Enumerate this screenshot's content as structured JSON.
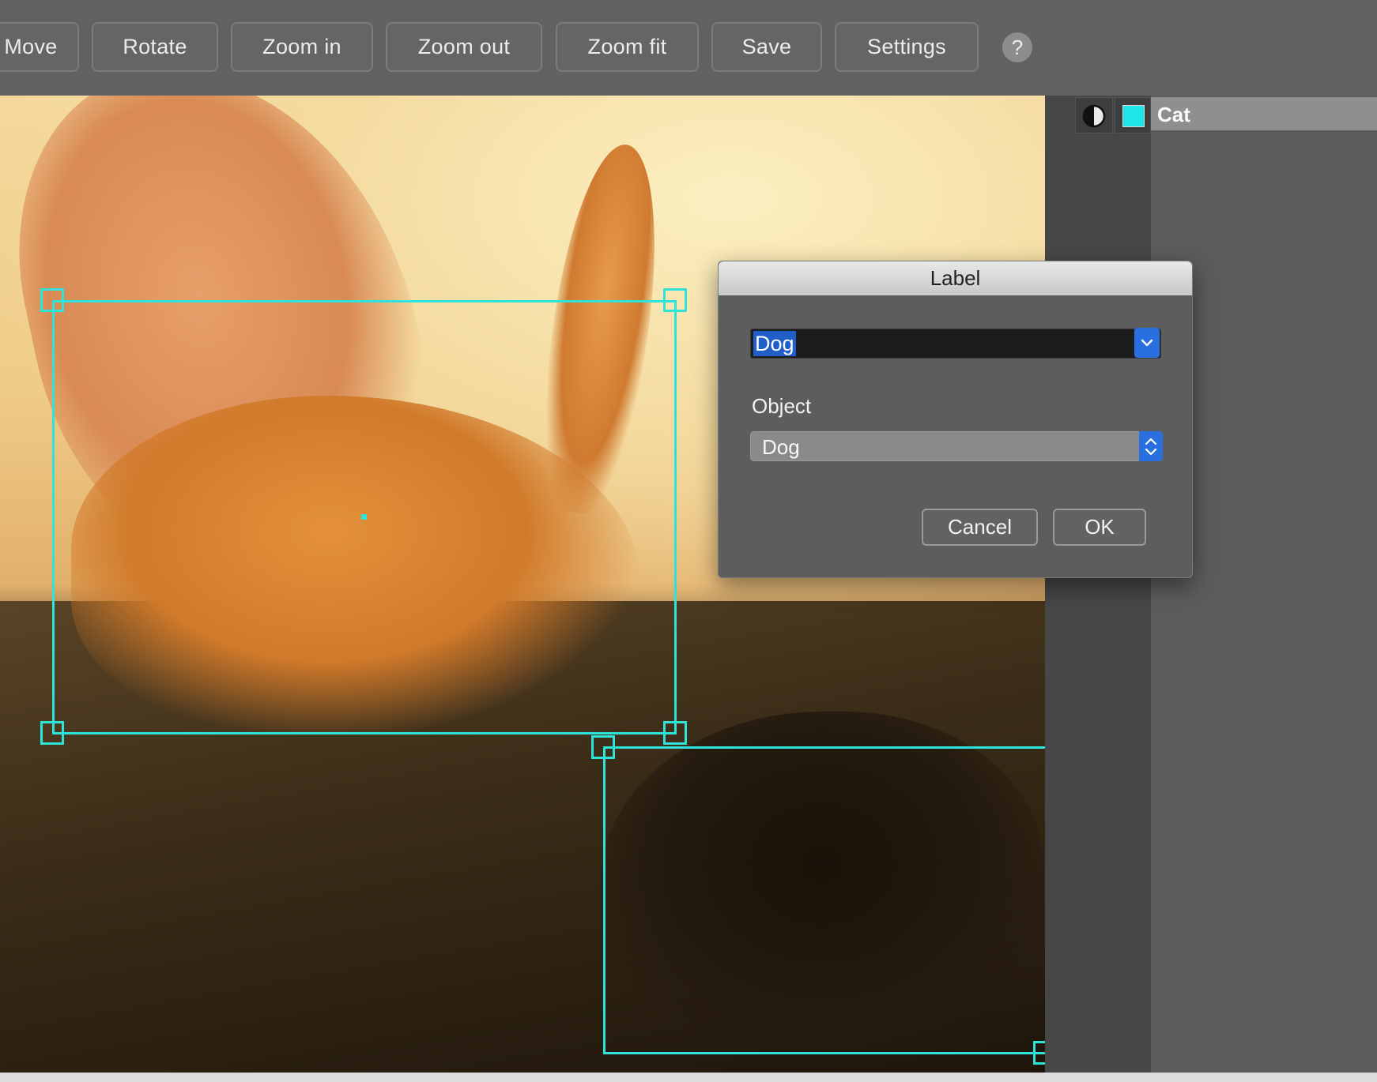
{
  "toolbar": {
    "buttons": [
      {
        "label": "Move"
      },
      {
        "label": "Rotate"
      },
      {
        "label": "Zoom in"
      },
      {
        "label": "Zoom out"
      },
      {
        "label": "Zoom fit"
      },
      {
        "label": "Save"
      },
      {
        "label": "Settings"
      }
    ],
    "help_label": "?"
  },
  "side_panel": {
    "label_name": "Cat",
    "color": "#1ee6ea",
    "contrast_icon": "contrast-icon"
  },
  "dialog": {
    "title": "Label",
    "combo_value": "Dog",
    "object_label": "Object",
    "object_value": "Dog",
    "cancel_label": "Cancel",
    "ok_label": "OK"
  },
  "annotation_color": "#2ee3da"
}
